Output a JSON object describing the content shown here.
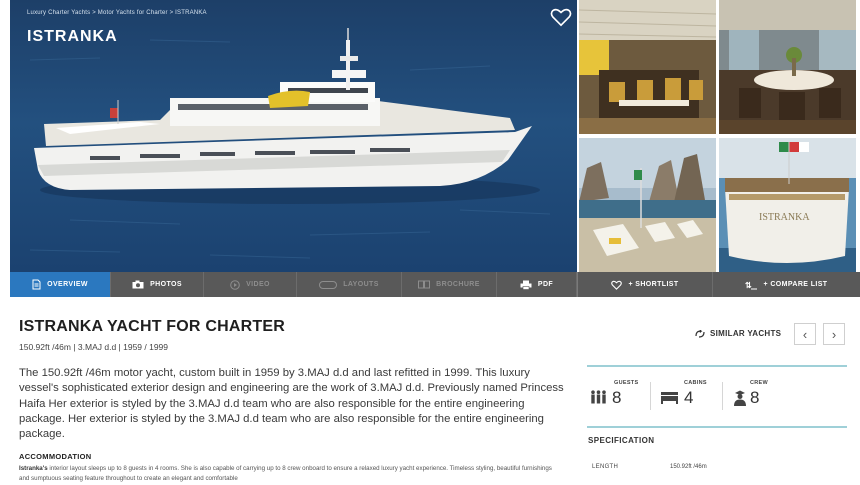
{
  "hero": {
    "breadcrumb": "Luxury Charter Yachts > Motor Yachts for Charter > ISTRANKA",
    "title": "ISTRANKA"
  },
  "toolbar": {
    "overview": "OVERVIEW",
    "photos": "PHOTOS",
    "video": "VIDEO",
    "layouts": "LAYOUTS",
    "brochure": "BROCHURE",
    "pdf": "PDF",
    "shortlist": "+ SHORTLIST",
    "compare": "+ COMPARE LIST"
  },
  "main": {
    "heading": "ISTRANKA YACHT FOR CHARTER",
    "subtitle": "150.92ft /46m | 3.MAJ d.d | 1959 / 1999",
    "description": "The 150.92ft /46m motor yacht, custom built in 1959 by 3.MAJ d.d and last refitted in 1999. This luxury vessel's sophisticated exterior design and engineering are the work of 3.MAJ d.d. Previously named Princess Haifa Her exterior is styled by the 3.MAJ d.d team who are also responsible for the entire engineering package. Her exterior is styled by the 3.MAJ d.d team who are also responsible for the entire engineering package.",
    "accommodation_heading": "ACCOMMODATION",
    "accommodation_name": "Istranka's",
    "accommodation_text": "interior layout sleeps up to 8 guests in 4 rooms. She is also capable of carrying up to 8 crew onboard to ensure a relaxed luxury yacht experience. Timeless styling, beautiful furnishings and sumptuous seating feature throughout to create an elegant and comfortable"
  },
  "side": {
    "similar_label": "SIMILAR YACHTS",
    "prev_glyph": "‹",
    "next_glyph": "›",
    "stats": {
      "guests_label": "GUESTS",
      "guests": "8",
      "cabins_label": "CABINS",
      "cabins": "4",
      "crew_label": "CREW",
      "crew": "8"
    },
    "spec_heading": "SPECIFICATION",
    "spec": {
      "length_label": "LENGTH",
      "length_value": "150.92ft /46m"
    }
  },
  "colors": {
    "active_tab": "#2b78bf",
    "toolbar": "#595959",
    "accent_rule": "#9fd0d8"
  },
  "icons": [
    "heart-icon",
    "document-icon",
    "camera-icon",
    "play-icon",
    "layout-icon",
    "book-icon",
    "printer-icon",
    "compare-icon",
    "similar-icon",
    "guests-icon",
    "cabins-icon",
    "crew-icon"
  ]
}
